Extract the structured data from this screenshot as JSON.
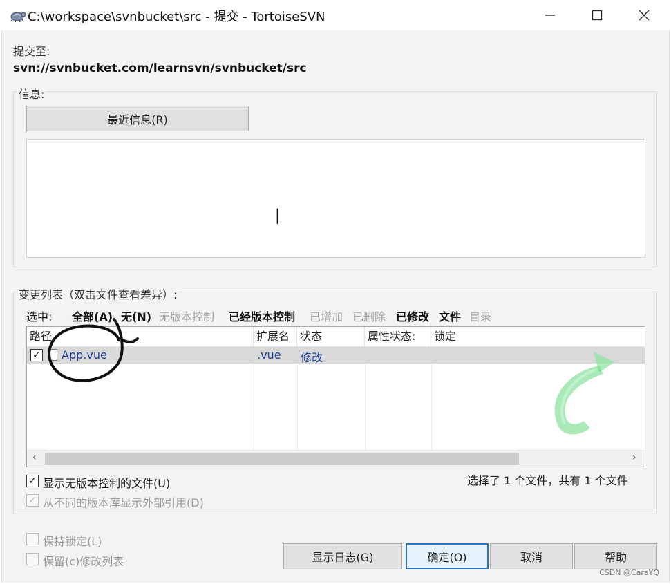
{
  "window": {
    "title": "C:\\workspace\\svnbucket\\src - 提交 - TortoiseSVN",
    "icon": "tortoise-icon"
  },
  "commit_to": {
    "label": "提交至:",
    "url": "svn://svnbucket.com/learnsvn/svnbucket/src"
  },
  "message": {
    "group_label": "信息:",
    "recent_button": "最近信息(R)",
    "text": ""
  },
  "changes": {
    "group_label": "变更列表（双击文件查看差异）:",
    "select_label": "选中:",
    "filters": [
      {
        "label": "全部(A)",
        "enabled": true
      },
      {
        "label": "无(N)",
        "enabled": true
      },
      {
        "label": "无版本控制",
        "enabled": false
      },
      {
        "label": "已经版本控制",
        "enabled": true
      },
      {
        "label": "已增加",
        "enabled": false
      },
      {
        "label": "已删除",
        "enabled": false
      },
      {
        "label": "已修改",
        "enabled": true
      },
      {
        "label": "文件",
        "enabled": true
      },
      {
        "label": "目录",
        "enabled": false
      }
    ],
    "columns": [
      "路径",
      "扩展名",
      "状态",
      "属性状态:",
      "锁定"
    ],
    "rows": [
      {
        "checked": true,
        "path": "App.vue",
        "ext": ".vue",
        "status": "修改",
        "prop_status": "",
        "lock": ""
      }
    ],
    "summary": "选择了 1 个文件，共有 1 个文件"
  },
  "options": {
    "show_unversioned": "显示无版本控制的文件(U)",
    "show_externals": "从不同的版本库显示外部引用(D)",
    "keep_locks": "保持锁定(L)",
    "keep_changelists": "保留(c)修改列表"
  },
  "buttons": {
    "show_log": "显示日志(G)",
    "ok": "确定(O)",
    "cancel": "取消",
    "help": "帮助"
  },
  "watermark": "CSDN @CaraYQ",
  "colors": {
    "dialog_bg": "#f3f3f3",
    "accent": "#2b74c8",
    "link_blue": "#1b3f95",
    "watermark_green": "#5fd57a"
  }
}
